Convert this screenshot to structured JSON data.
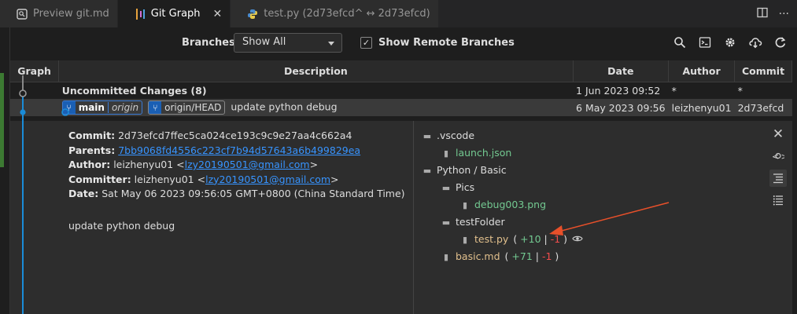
{
  "tabs": [
    {
      "label": "Preview git.md",
      "icon": "preview-icon",
      "active": false
    },
    {
      "label": "Git Graph",
      "icon": "git-graph-icon",
      "active": true
    },
    {
      "label": "test.py (2d73efcd^ ↔ 2d73efcd)",
      "icon": "python-icon",
      "active": false
    }
  ],
  "controls": {
    "branches_label": "Branches:",
    "branches_value": "Show All",
    "show_remote_label": "Show Remote Branches",
    "show_remote_checked": true
  },
  "table": {
    "headers": [
      "Graph",
      "Description",
      "Date",
      "Author",
      "Commit"
    ],
    "uncommitted": {
      "description": "Uncommitted Changes (8)",
      "date": "1 Jun 2023 09:52",
      "author": "*",
      "commit": "*"
    },
    "commit_row": {
      "ref_main": "main",
      "ref_main_remote": "origin",
      "ref_head": "origin/HEAD",
      "message": "update python debug",
      "date": "6 May 2023 09:56",
      "author": "leizhenyu01",
      "commit": "2d73efcd"
    }
  },
  "details": {
    "commit_label": "Commit:",
    "commit_value": "2d73efcd7ffec5ca024ce193c9c9e27aa4c662a4",
    "parents_label": "Parents:",
    "parents_value": "7bb9068fd4556c223cf7b94d57643a6b499829ea",
    "author_label": "Author:",
    "author_name": "leizhenyu01",
    "author_email": "lzy20190501@gmail.com",
    "committer_label": "Committer:",
    "committer_name": "leizhenyu01",
    "committer_email": "lzy20190501@gmail.com",
    "date_label": "Date:",
    "date_value": "Sat May 06 2023 09:56:05 GMT+0800 (China Standard Time)",
    "message": "update python debug",
    "tree": {
      "folder_vscode": ".vscode",
      "file_launch": "launch.json",
      "folder_python": "Python / Basic",
      "folder_pics": "Pics",
      "file_debug": "debug003.png",
      "folder_test": "testFolder",
      "file_test": "test.py",
      "test_add": "+10",
      "test_del": "-1",
      "file_basic": "basic.md",
      "basic_add": "+71",
      "basic_del": "-1"
    }
  },
  "colors": {
    "accent": "#1a8cd8",
    "added": "#73c991",
    "deleted": "#f14c4c",
    "link": "#3794ff"
  }
}
